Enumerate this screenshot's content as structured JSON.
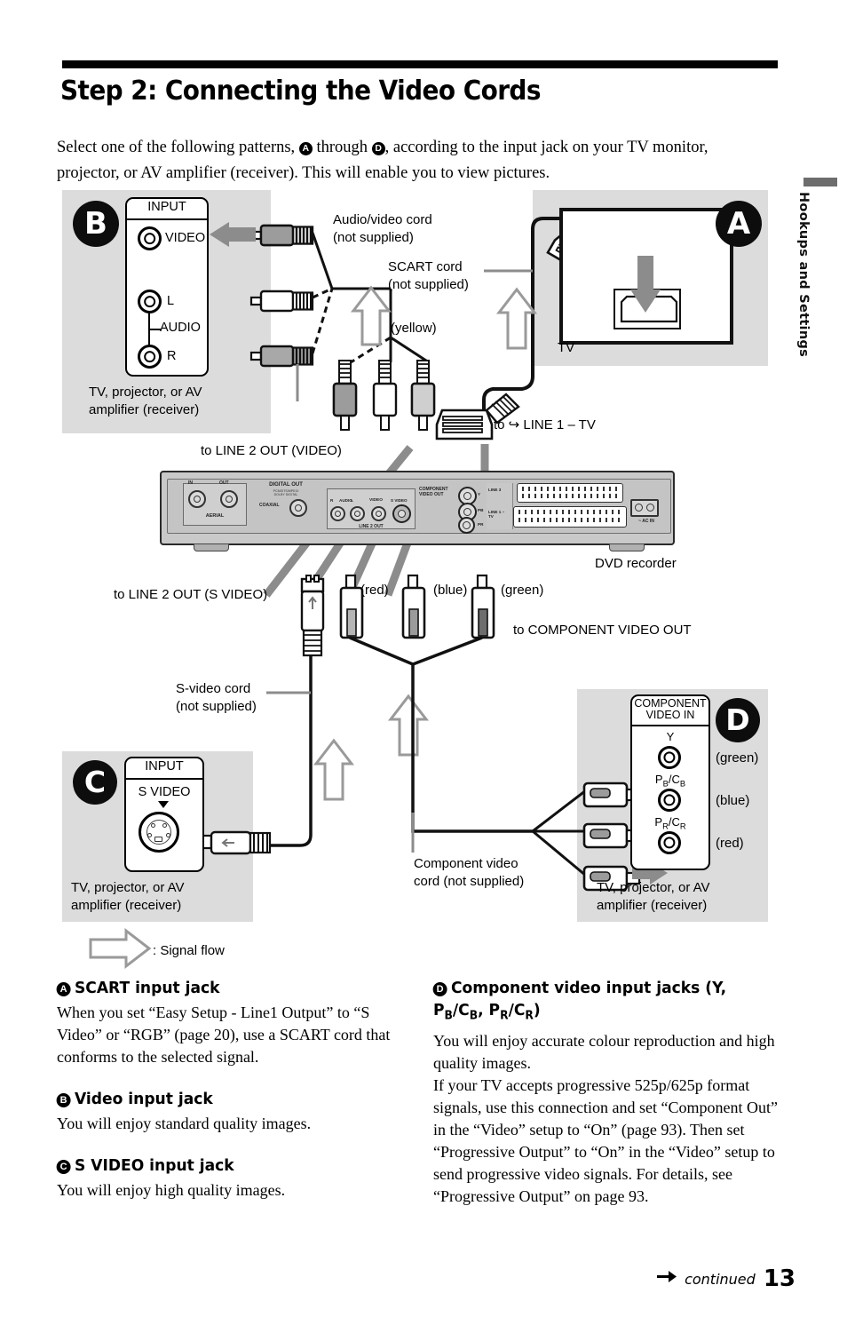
{
  "header": {
    "title": "Step 2: Connecting the Video Cords",
    "intro_pre": "Select one of the following patterns, ",
    "intro_a": "A",
    "intro_mid": " through ",
    "intro_d": "D",
    "intro_post": ", according to the input jack on your TV monitor, projector, or AV amplifier (receiver). This will enable you to view pictures."
  },
  "side_tab": {
    "label": "Hookups and Settings"
  },
  "diagram": {
    "panel_b": {
      "letter": "B",
      "input_label": "INPUT",
      "jacks": [
        "VIDEO",
        "L",
        "R"
      ],
      "audio_label": "AUDIO",
      "caption": "TV, projector, or AV\namplifier (receiver)"
    },
    "panel_a": {
      "letter": "A",
      "caption": "TV"
    },
    "panel_c": {
      "letter": "C",
      "input_label": "INPUT",
      "jack_label": "S VIDEO",
      "caption": "TV, projector, or AV\namplifier (receiver)"
    },
    "panel_d": {
      "letter": "D",
      "title_line1": "COMPONENT",
      "title_line2": "VIDEO IN",
      "jacks": [
        {
          "name": "Y",
          "colour": "(green)"
        },
        {
          "name": "PB/CB",
          "colour": "(blue)"
        },
        {
          "name": "PR/CR",
          "colour": "(red)"
        }
      ],
      "caption": "TV, projector, or AV\namplifier (receiver)"
    },
    "labels": {
      "av_cord": "Audio/video cord\n(not supplied)",
      "scart_cord": "SCART cord\n(not supplied)",
      "yellow": "(yellow)",
      "to_line1_tv": "to ↪ LINE 1 – TV",
      "to_line2_video": "to LINE 2 OUT (VIDEO)",
      "to_line2_svideo": "to LINE 2 OUT (S VIDEO)",
      "to_component": "to COMPONENT VIDEO OUT",
      "svideo_cord": "S-video cord\n(not supplied)",
      "component_cord": "Component video\ncord (not supplied)",
      "dvd_recorder": "DVD recorder",
      "plug_red": "(red)",
      "plug_blue": "(blue)",
      "plug_green": "(green)",
      "signal_flow": ": Signal flow"
    },
    "rear_panel": {
      "aerial": "AERIAL",
      "aerial_in": "IN",
      "aerial_out": "OUT",
      "digital_out": "DIGITAL OUT",
      "digital_sub": "PCM/DTS/MPEG/\nDOLBY DIGITAL",
      "coaxial": "COAXIAL",
      "line2_out": "LINE 2 OUT",
      "audio": "AUDIO",
      "audio_r": "R",
      "audio_l": "L",
      "video": "VIDEO",
      "s_video": "S VIDEO",
      "component": "COMPONENT\nVIDEO OUT",
      "comp_y": "Y",
      "comp_pb": "PB",
      "comp_pr": "PR",
      "line3": "LINE 3",
      "line1_tv": "LINE 1 –\nTV",
      "ac_in": "~ AC IN"
    }
  },
  "notes": [
    {
      "letter": "A",
      "heading": "SCART input jack",
      "body": "When you set “Easy Setup - Line1 Output” to “S Video” or “RGB” (page 20), use a SCART cord that conforms to the selected signal."
    },
    {
      "letter": "B",
      "heading": "Video input jack",
      "body": "You will enjoy standard quality images."
    },
    {
      "letter": "C",
      "heading": "S VIDEO input jack",
      "body": "You will enjoy high quality images."
    }
  ],
  "note_d": {
    "letter": "D",
    "heading_p1": "Component video input jacks (Y, P",
    "heading_sub1": "B",
    "heading_p2": "/C",
    "heading_sub2": "B",
    "heading_p3": ", P",
    "heading_sub3": "R",
    "heading_p4": "/C",
    "heading_sub4": "R",
    "heading_p5": ")",
    "body": "You will enjoy accurate colour reproduction and high quality images.\nIf your TV accepts progressive 525p/625p format signals, use this connection and set “Component Out” in the “Video” setup to “On” (page 93). Then set “Progressive Output” to “On” in the “Video” setup to send progressive video signals. For details, see “Progressive Output” on page 93."
  },
  "footer": {
    "continued": "continued",
    "page_number": "13"
  },
  "colors": {
    "panel_grey": "#dcdcdc",
    "arrow_grey": "#8c8c8c",
    "ink": "#000000",
    "device_grey": "#c9c9c9"
  }
}
